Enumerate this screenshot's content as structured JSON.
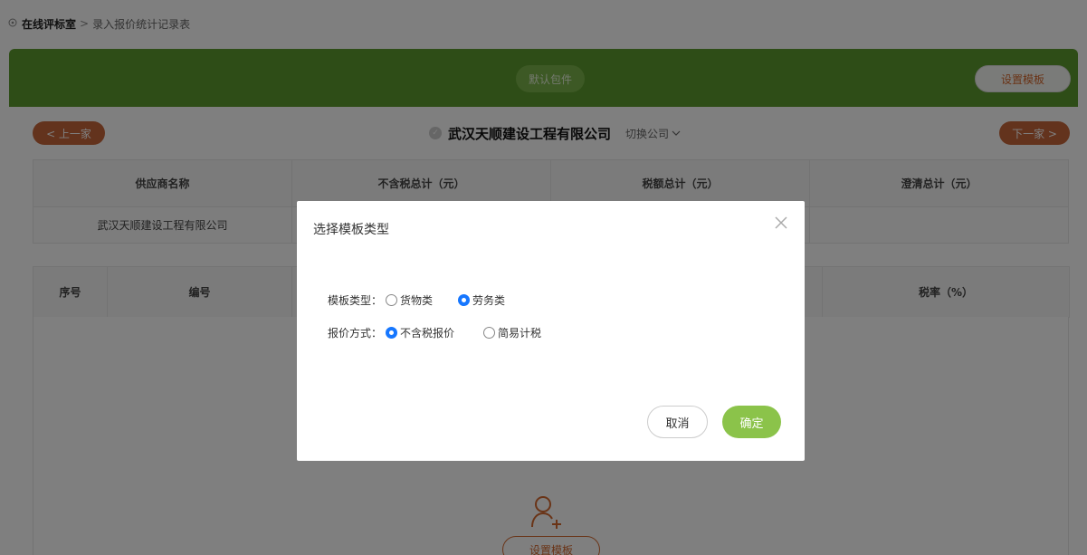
{
  "breadcrumb": {
    "home": "在线评标室",
    "separator": ">",
    "current": "录入报价统计记录表"
  },
  "header": {
    "package_label": "默认包件",
    "set_template_label": "设置模板"
  },
  "nav": {
    "prev_label": "< 上一家",
    "next_label": "下一家 >"
  },
  "company": {
    "name": "武汉天顺建设工程有限公司",
    "switch_label": "切换公司"
  },
  "summary_table": {
    "headers": [
      "供应商名称",
      "不含税总计（元）",
      "税额总计（元）",
      "澄清总计（元）"
    ],
    "rows": [
      [
        "武汉天顺建设工程有限公司",
        "",
        "",
        ""
      ]
    ]
  },
  "detail_table": {
    "headers": [
      "序号",
      "编号",
      "",
      "",
      "税率（%）"
    ]
  },
  "empty_state": {
    "icon": "add-user-icon",
    "button_label": "设置模板"
  },
  "modal": {
    "title": "选择模板类型",
    "close_icon": "close-icon",
    "type_label": "模板类型：",
    "type_options": [
      {
        "label": "货物类",
        "selected": false
      },
      {
        "label": "劳务类",
        "selected": true
      }
    ],
    "method_label": "报价方式：",
    "method_options": [
      {
        "label": "不含税报价",
        "selected": true
      },
      {
        "label": "简易计税",
        "selected": false
      }
    ],
    "cancel_label": "取消",
    "confirm_label": "确定"
  },
  "colors": {
    "green_bar": "#5d9a2e",
    "nav_button": "#c7663a",
    "confirm": "#8bc34a",
    "radio_on": "#1677ff",
    "accent_text": "#d4682e"
  }
}
